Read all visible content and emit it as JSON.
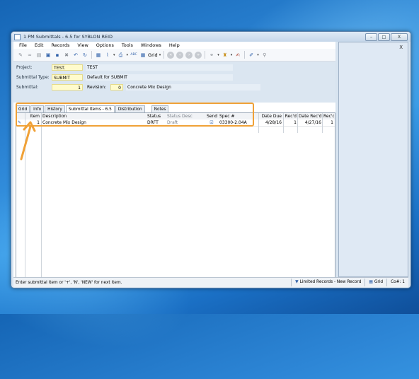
{
  "window": {
    "title": "1 PM Submittals - 6.5 for SYBLON REID",
    "min_glyph": "–",
    "max_glyph": "□",
    "close_glyph": "X"
  },
  "menubar": [
    "File",
    "Edit",
    "Records",
    "View",
    "Options",
    "Tools",
    "Windows",
    "Help"
  ],
  "toolbar": {
    "grid_label": "Grid",
    "spell_label": "ABC"
  },
  "form": {
    "project_label": "Project:",
    "project_value": "TEST.",
    "project_desc": "TEST",
    "submittal_type_label": "Submittal Type:",
    "submittal_type_value": "SUBMIT",
    "submittal_type_desc": "Default for SUBMIT",
    "submittal_label": "Submittal:",
    "submittal_value": "1",
    "revision_label": "Revision:",
    "revision_value": "0",
    "revision_desc": "Concrete Mix Design"
  },
  "tabs": [
    "Grid",
    "Info",
    "History",
    "Submittal Items - 6.5",
    "Distribution",
    "Notes"
  ],
  "grid": {
    "headers": {
      "item": "Item",
      "description": "Description",
      "status": "Status",
      "status_desc": "Status Desc",
      "send": "Send",
      "spec": "Spec #",
      "date_due": "Date Due",
      "recd1": "Rec'd",
      "date_recd": "Date Rec'd",
      "recd2": "Rec'd"
    },
    "row": {
      "marker": "✎",
      "item": "1",
      "description": "Concrete Mix Design",
      "status": "DRFT",
      "status_desc": "Draft",
      "send": "☑",
      "spec": "03300-2.04A",
      "date_due": "4/28/16",
      "recd1": "1",
      "date_recd": "4/27/16",
      "recd2": "1"
    }
  },
  "statusbar": {
    "message": "Enter submittal item or '+', 'N', 'NEW' for next item.",
    "limited": "Limited Records - New Record",
    "grid": "Grid",
    "co": "Co#: 1"
  },
  "right_pane": {
    "close_label": "X"
  },
  "colors": {
    "highlight": "#f0a137",
    "accent": "#2c5ea8"
  }
}
